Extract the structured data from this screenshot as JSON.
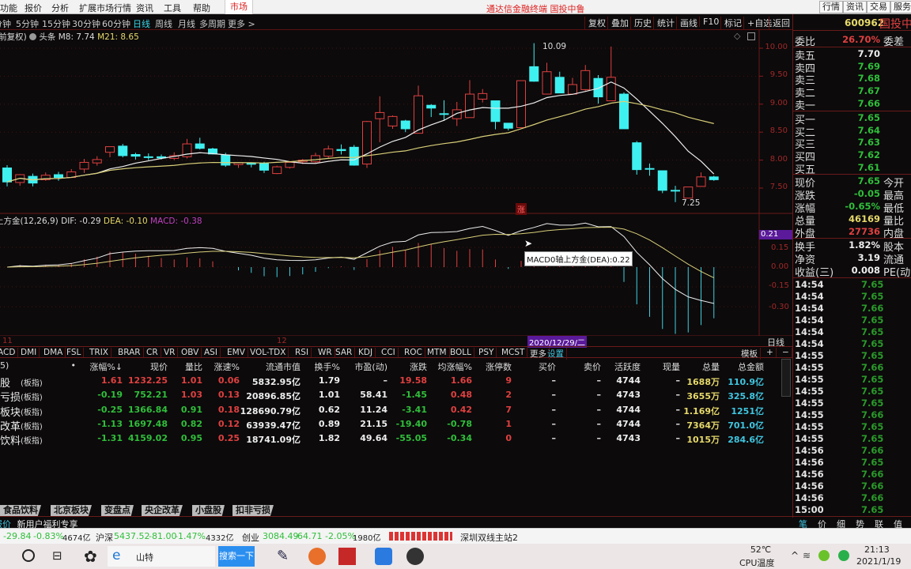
{
  "menu": {
    "items": [
      "功能",
      "报价",
      "分析",
      "扩展市场行情",
      "资讯",
      "工具",
      "帮助"
    ],
    "market": "市场",
    "title": "通达信金融终端 国投中鲁",
    "right_buttons": [
      "行情",
      "资讯",
      "交易",
      "服务"
    ]
  },
  "periods": {
    "items": [
      "分钟",
      "5分钟",
      "15分钟",
      "30分钟",
      "60分钟",
      "日线",
      "周线",
      "月线",
      "多周期",
      "更多 >"
    ],
    "active": "日线"
  },
  "toolbar": [
    "复权",
    "叠加",
    "历史",
    "统计",
    "画线",
    "F10",
    "标记",
    "+自选",
    "返回"
  ],
  "chart": {
    "info": {
      "prefix": "(前复权)",
      "headline": "头条",
      "m8": "M8: 7.74",
      "m21": "M21: 8.65"
    },
    "price_axis": [
      "10.00",
      "9.50",
      "9.00",
      "8.50",
      "8.00",
      "7.50"
    ],
    "high_label": "10.09",
    "low_label": "7.25",
    "rise_tag": "涨",
    "candles": [
      [
        7.86,
        7.91,
        7.53,
        7.61
      ],
      [
        7.6,
        7.75,
        7.54,
        7.74
      ],
      [
        7.71,
        7.76,
        7.53,
        7.59
      ],
      [
        7.65,
        7.78,
        7.63,
        7.73
      ],
      [
        7.74,
        7.79,
        7.63,
        7.69
      ],
      [
        7.69,
        7.84,
        7.68,
        7.79
      ],
      [
        7.84,
        8.02,
        7.77,
        7.96
      ],
      [
        7.95,
        8.07,
        7.9,
        8.01
      ],
      [
        8.14,
        8.24,
        8.05,
        8.24
      ],
      [
        8.25,
        8.29,
        8.05,
        8.08
      ],
      [
        8.1,
        8.13,
        8.01,
        8.07
      ],
      [
        8.06,
        8.12,
        8.0,
        8.05
      ],
      [
        8.06,
        8.1,
        8.01,
        8.04
      ],
      [
        8.03,
        8.14,
        8.0,
        8.08
      ],
      [
        8.06,
        8.38,
        8.03,
        8.29
      ],
      [
        8.29,
        8.4,
        8.19,
        8.21
      ],
      [
        8.2,
        8.22,
        8.1,
        8.11
      ],
      [
        8.09,
        8.13,
        7.88,
        7.91
      ],
      [
        7.92,
        7.96,
        7.86,
        7.95
      ],
      [
        7.94,
        7.96,
        7.87,
        7.93
      ],
      [
        7.94,
        7.97,
        7.77,
        7.82
      ],
      [
        7.76,
        7.9,
        7.75,
        7.88
      ],
      [
        7.87,
        7.98,
        7.85,
        7.96
      ],
      [
        7.97,
        8.02,
        7.93,
        8.0
      ],
      [
        7.97,
        8.13,
        7.95,
        8.08
      ],
      [
        8.07,
        8.26,
        8.04,
        8.2
      ],
      [
        8.19,
        8.28,
        8.1,
        8.17
      ],
      [
        8.23,
        8.27,
        7.9,
        7.91
      ],
      [
        7.93,
        8.7,
        7.86,
        8.69
      ],
      [
        8.74,
        9.14,
        8.32,
        8.85
      ],
      [
        8.61,
        8.8,
        8.56,
        8.78
      ],
      [
        8.7,
        8.72,
        8.5,
        8.56
      ],
      [
        8.48,
        9.33,
        8.48,
        9.15
      ],
      [
        8.98,
        9.0,
        8.77,
        8.93
      ],
      [
        8.83,
        9.07,
        8.7,
        8.82
      ],
      [
        8.74,
        9.04,
        8.61,
        8.9
      ],
      [
        8.76,
        9.43,
        8.76,
        9.18
      ],
      [
        9.09,
        9.27,
        9.03,
        9.19
      ],
      [
        9.06,
        9.06,
        8.55,
        8.69
      ],
      [
        8.66,
        8.66,
        8.53,
        8.57
      ],
      [
        8.58,
        9.42,
        8.58,
        9.42
      ],
      [
        9.67,
        10.09,
        9.4,
        9.41
      ],
      [
        9.18,
        9.74,
        9.18,
        9.58
      ],
      [
        9.48,
        9.58,
        9.2,
        9.2
      ],
      [
        9.18,
        9.47,
        9.17,
        9.35
      ],
      [
        9.26,
        9.7,
        9.24,
        9.6
      ],
      [
        9.46,
        9.52,
        9.01,
        9.13
      ],
      [
        9.06,
        10.03,
        9.06,
        9.48
      ],
      [
        9.18,
        9.21,
        8.56,
        8.56
      ],
      [
        8.31,
        8.34,
        7.74,
        7.83
      ],
      [
        7.85,
        7.94,
        7.72,
        7.84
      ],
      [
        7.81,
        7.81,
        7.41,
        7.46
      ],
      [
        7.46,
        7.54,
        7.25,
        7.45
      ],
      [
        7.32,
        7.52,
        7.32,
        7.52
      ],
      [
        7.53,
        7.78,
        7.53,
        7.7
      ],
      [
        7.7,
        7.72,
        7.63,
        7.65
      ]
    ],
    "colors": {
      "up": "#e04040",
      "down": "#3ff0f0",
      "ma8": "#eeeeee",
      "ma21": "#d8cf78"
    }
  },
  "macd": {
    "label": "上方金(12,26,9)",
    "dif": "DIF: -0.29",
    "dea": "DEA: -0.10",
    "macd": "MACD: -0.38",
    "axis": [
      "0.15",
      "0.00",
      "-0.15",
      "-0.30"
    ],
    "current_tag": "0.21",
    "tooltip": "MACD0轴上方金(DEA):0.22"
  },
  "date_axis": {
    "labels": [
      "11",
      "12"
    ],
    "cursor_date": "2020/12/29/二",
    "period": "日线"
  },
  "indicators": [
    "ACD",
    "DMI",
    "DMA",
    "FSL",
    "TRIX",
    "BRAR",
    "CR",
    "VR",
    "OBV",
    "ASI",
    "EMV",
    "VOL-TDX",
    "RSI",
    "WR",
    "SAR",
    "KDJ",
    "CCI",
    "ROC",
    "MTM",
    "BOLL",
    "PSY",
    "MCST",
    "更多",
    "设置"
  ],
  "template_controls": [
    "模板",
    "+",
    "−"
  ],
  "table": {
    "headers": [
      "5)",
      "•",
      "涨幅%↓",
      "现价",
      "量比",
      "涨速%",
      "流通市值",
      "换手%",
      "市盈(动)",
      "涨跌",
      "均涨幅%",
      "涨停数",
      "买价",
      "卖价",
      "活跃度",
      "现量",
      "总量",
      "总金额"
    ],
    "rows": [
      [
        "股",
        "(板指)",
        "1.61",
        "1232.25",
        "1.01",
        "0.06",
        "5832.95亿",
        "1.79",
        "–",
        "19.58",
        "1.66",
        "9",
        "–",
        "–",
        "4744",
        "–",
        "1688万",
        "110.9亿"
      ],
      [
        "亏损",
        "(板指)",
        "-0.19",
        "752.21",
        "1.03",
        "0.13",
        "20896.85亿",
        "1.01",
        "58.41",
        "-1.45",
        "0.48",
        "2",
        "–",
        "–",
        "4743",
        "–",
        "3655万",
        "325.8亿"
      ],
      [
        "板块",
        "(板指)",
        "-0.25",
        "1366.84",
        "0.91",
        "0.18",
        "128690.79亿",
        "0.62",
        "11.24",
        "-3.41",
        "0.42",
        "7",
        "–",
        "–",
        "4744",
        "–",
        "1.169亿",
        "1251亿"
      ],
      [
        "改革",
        "(板指)",
        "-1.13",
        "1697.48",
        "0.82",
        "0.12",
        "63939.47亿",
        "0.89",
        "21.15",
        "-19.40",
        "-0.78",
        "1",
        "–",
        "–",
        "4744",
        "–",
        "7364万",
        "701.0亿"
      ],
      [
        "饮料",
        "(板指)",
        "-1.31",
        "4159.02",
        "0.95",
        "0.25",
        "18741.09亿",
        "1.82",
        "49.64",
        "-55.05",
        "-0.34",
        "0",
        "–",
        "–",
        "4743",
        "–",
        "1015万",
        "284.6亿"
      ]
    ]
  },
  "sheets": [
    "食品饮料",
    "北京板块",
    "变盘点",
    "央企改革",
    "小盘股",
    "扣非亏损"
  ],
  "news": {
    "tag": "报价",
    "text": "新用户福利专享"
  },
  "quote": {
    "code": "600962",
    "name": "国投中鲁",
    "weibi": {
      "label": "委比",
      "value": "26.70%",
      "label2": "委差"
    },
    "asks": [
      {
        "label": "卖五",
        "price": "7.70"
      },
      {
        "label": "卖四",
        "price": "7.69"
      },
      {
        "label": "卖三",
        "price": "7.68"
      },
      {
        "label": "卖二",
        "price": "7.67"
      },
      {
        "label": "卖一",
        "price": "7.66"
      }
    ],
    "bids": [
      {
        "label": "买一",
        "price": "7.65"
      },
      {
        "label": "买二",
        "price": "7.64"
      },
      {
        "label": "买三",
        "price": "7.63"
      },
      {
        "label": "买四",
        "price": "7.62"
      },
      {
        "label": "买五",
        "price": "7.61"
      }
    ],
    "stats": [
      {
        "label": "现价",
        "value": "7.65",
        "label2": "今开"
      },
      {
        "label": "涨跌",
        "value": "-0.05",
        "label2": "最高"
      },
      {
        "label": "涨幅",
        "value": "-0.65%",
        "label2": "最低"
      },
      {
        "label": "总量",
        "value": "46169",
        "label2": "量比"
      },
      {
        "label": "外盘",
        "value": "27736",
        "label2": "内盘"
      }
    ],
    "fund": [
      {
        "label": "换手",
        "value": "1.82%",
        "label2": "股本"
      },
      {
        "label": "净资",
        "value": "3.19",
        "label2": "流通"
      },
      {
        "label": "收益(三)",
        "value": "0.008",
        "label2": "PE(动)"
      }
    ]
  },
  "ticks": [
    [
      "14:54",
      "7.65"
    ],
    [
      "14:54",
      "7.65"
    ],
    [
      "14:54",
      "7.66"
    ],
    [
      "14:54",
      "7.65"
    ],
    [
      "14:54",
      "7.65"
    ],
    [
      "14:54",
      "7.65"
    ],
    [
      "14:55",
      "7.65"
    ],
    [
      "14:55",
      "7.66"
    ],
    [
      "14:55",
      "7.65"
    ],
    [
      "14:55",
      "7.65"
    ],
    [
      "14:55",
      "7.65"
    ],
    [
      "14:55",
      "7.66"
    ],
    [
      "14:55",
      "7.65"
    ],
    [
      "14:55",
      "7.65"
    ],
    [
      "14:56",
      "7.66"
    ],
    [
      "14:56",
      "7.65"
    ],
    [
      "14:56",
      "7.66"
    ],
    [
      "14:56",
      "7.66"
    ],
    [
      "14:56",
      "7.66"
    ],
    [
      "15:00",
      "7.65"
    ]
  ],
  "right_tabs": [
    "笔",
    "价",
    "细",
    "势",
    "联",
    "值"
  ],
  "status": {
    "items": [
      "-29.84",
      "-0.83%",
      "4674亿",
      "沪深",
      "5437.52",
      "-81.00",
      "-1.47%",
      "4332亿",
      "创业",
      "3084.49",
      "-64.71",
      "-2.05%",
      "1980亿"
    ],
    "server": "深圳双线主站2"
  },
  "taskbar": {
    "search_text": "山特",
    "search_button": "搜索一下",
    "temp": "52℃",
    "temp_label": "CPU温度",
    "time": "21:13",
    "date": "2021/1/19"
  }
}
